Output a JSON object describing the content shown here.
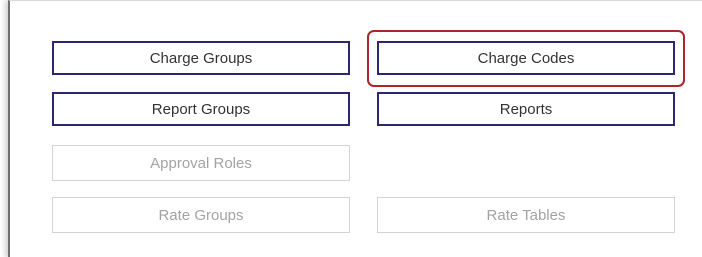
{
  "buttons": {
    "charge_groups": {
      "label": "Charge Groups",
      "enabled": true
    },
    "charge_codes": {
      "label": "Charge Codes",
      "enabled": true,
      "highlighted": true
    },
    "report_groups": {
      "label": "Report Groups",
      "enabled": true
    },
    "reports": {
      "label": "Reports",
      "enabled": true
    },
    "approval_roles": {
      "label": "Approval Roles",
      "enabled": false
    },
    "rate_groups": {
      "label": "Rate Groups",
      "enabled": false
    },
    "rate_tables": {
      "label": "Rate Tables",
      "enabled": false
    }
  },
  "colors": {
    "enabled_border": "#2b2775",
    "disabled_border": "#d3d3d3",
    "disabled_text": "#a3a3a3",
    "highlight": "#a8262c"
  }
}
